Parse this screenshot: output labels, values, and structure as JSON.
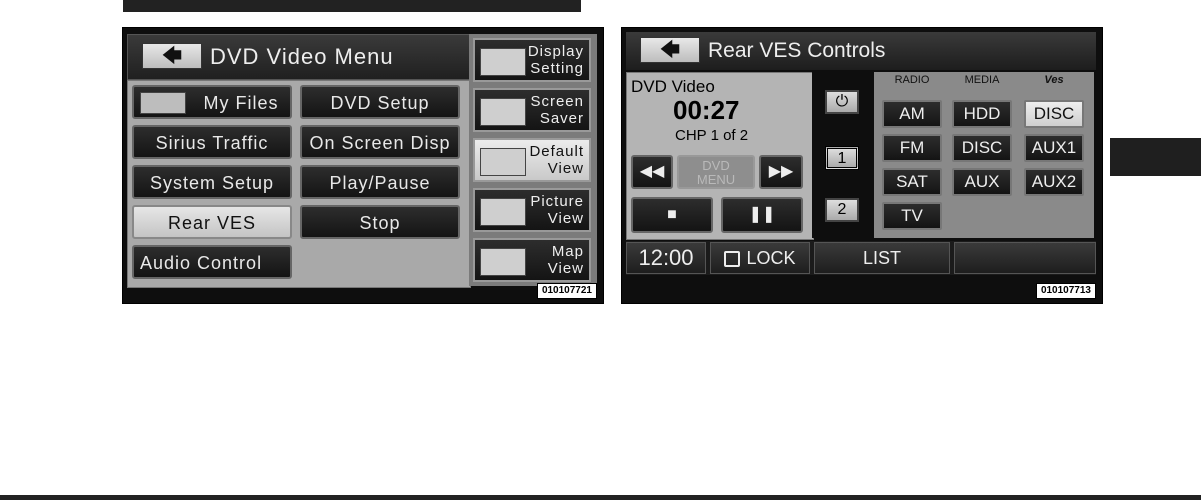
{
  "screen1": {
    "title": "DVD Video Menu",
    "back_glyph": "🡄",
    "buttons": [
      "My Files",
      "DVD Setup",
      "Sirius Traffic",
      "On Screen Disp",
      "System Setup",
      "Play/Pause",
      "Rear VES",
      "Stop",
      "Audio Control"
    ],
    "side": [
      {
        "line1": "Display",
        "line2": "Setting"
      },
      {
        "line1": "Screen",
        "line2": "Saver"
      },
      {
        "line1": "Default",
        "line2": "View"
      },
      {
        "line1": "Picture",
        "line2": "View"
      },
      {
        "line1": "Map",
        "line2": "View"
      }
    ],
    "code": "010107721"
  },
  "screen2": {
    "title": "Rear VES Controls",
    "back_glyph": "🡄",
    "source_label": "DVD Video",
    "time": "00:27",
    "chapter": "CHP 1 of 2",
    "dvd_menu_l1": "DVD",
    "dvd_menu_l2": "MENU",
    "rewind_glyph": "◀◀",
    "ff_glyph": "▶▶",
    "stop_glyph": "■",
    "pause_glyph": "❚❚",
    "power_glyph": "⏻",
    "num1": "1",
    "num2": "2",
    "col_heads": [
      "RADIO",
      "MEDIA",
      "Ves"
    ],
    "radio": [
      "AM",
      "FM",
      "SAT",
      "TV"
    ],
    "media": [
      "HDD",
      "DISC",
      "AUX"
    ],
    "ves": [
      "DISC",
      "AUX1",
      "AUX2"
    ],
    "clock": "12:00",
    "lock": "LOCK",
    "list": "LIST",
    "code": "010107713"
  },
  "colors": {
    "selected": "#d6d6d6",
    "panel": "#a9a9a9",
    "dark": "#141414"
  }
}
